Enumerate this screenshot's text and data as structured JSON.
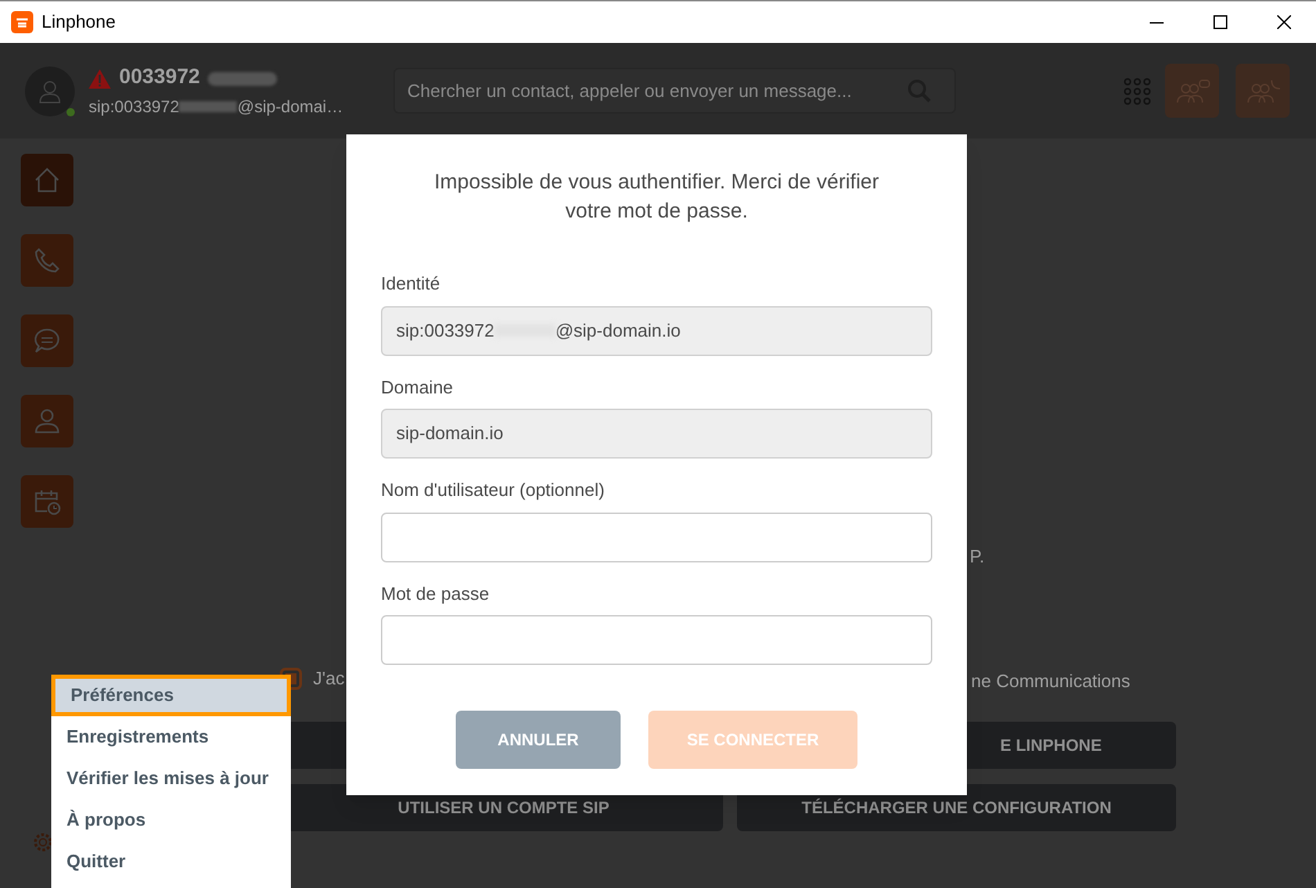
{
  "window": {
    "title": "Linphone"
  },
  "account": {
    "name": "0033972",
    "address_start": "sip:0033972",
    "address_end": "@sip-domai…",
    "warning": true
  },
  "search": {
    "placeholder": "Chercher un contact, appeler ou envoyer un message..."
  },
  "background": {
    "terms_checked": true,
    "terms_start": "J'ac",
    "terms_end": "ne Communications",
    "note": "P.",
    "buttons_row1": [
      "E LINPHONE"
    ],
    "buttons_row2": [
      "UTILISER UN COMPTE SIP",
      "TÉLÉCHARGER UNE CONFIGURATION"
    ]
  },
  "dialog": {
    "message": "Impossible de vous authentifier. Merci de vérifier votre mot de passe.",
    "fields": [
      {
        "label": "Identité",
        "readonly": true,
        "value_start": "sip:0033972",
        "value_end": "@sip-domain.io",
        "redacted": true
      },
      {
        "label": "Domaine",
        "readonly": true,
        "value_start": "sip-domain.io",
        "redacted": false
      },
      {
        "label": "Nom d'utilisateur (optionnel)",
        "readonly": false
      },
      {
        "label": "Mot de passe",
        "readonly": false
      }
    ],
    "buttons": [
      {
        "label": "ANNULER",
        "kind": "cancel",
        "disabled": false
      },
      {
        "label": "SE CONNECTER",
        "kind": "confirm",
        "disabled": true
      }
    ]
  },
  "menu": {
    "items": [
      {
        "label": "Préférences",
        "selected": true
      },
      {
        "label": "Enregistrements",
        "selected": false
      },
      {
        "label": "Vérifier les mises à jour",
        "selected": false
      },
      {
        "label": "À propos",
        "selected": false
      },
      {
        "label": "Quitter",
        "selected": false
      }
    ]
  }
}
